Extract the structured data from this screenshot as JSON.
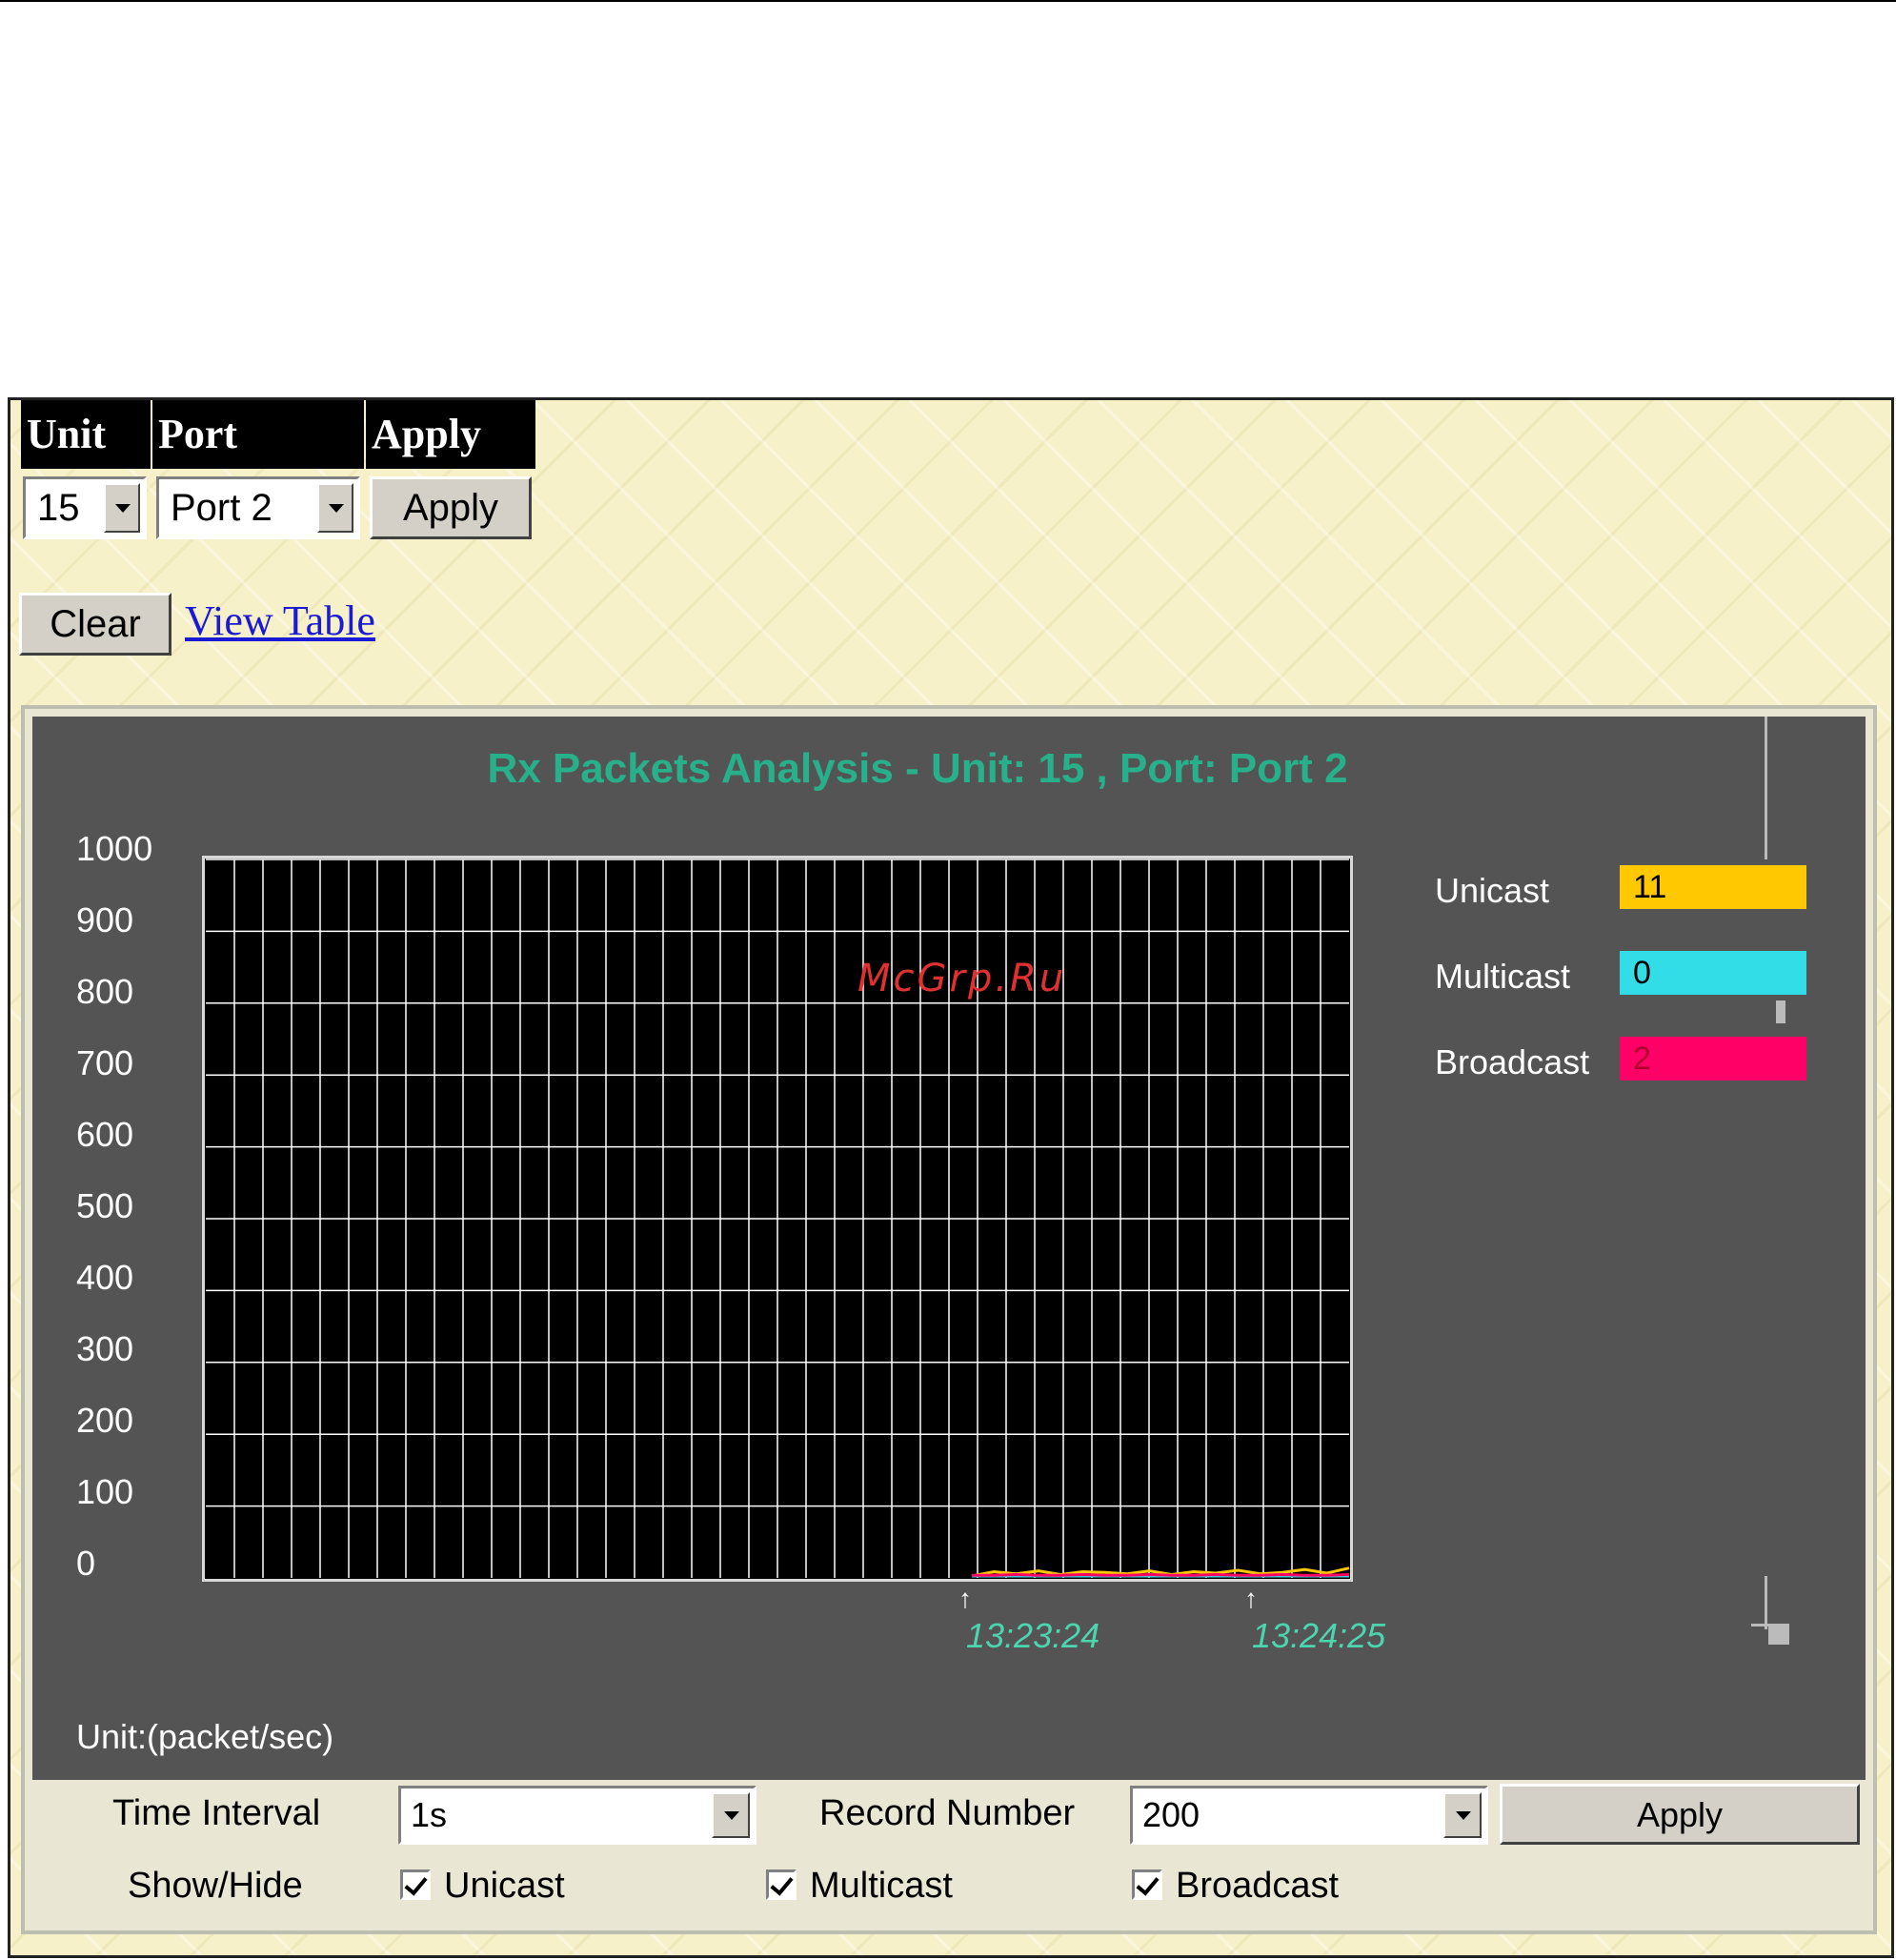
{
  "selector": {
    "unit_header": "Unit",
    "port_header": "Port",
    "apply_header": "Apply",
    "unit_value": "15",
    "port_value": "Port 2",
    "apply_label": "Apply"
  },
  "actions": {
    "clear_label": "Clear",
    "view_table_label": "View Table"
  },
  "watermark": "McGrp.Ru",
  "chart_data": {
    "type": "line",
    "title": "Rx Packets Analysis - Unit: 15 , Port: Port 2",
    "ylim": [
      0,
      1000
    ],
    "yticks": [
      "1000",
      "900",
      "800",
      "700",
      "600",
      "500",
      "400",
      "300",
      "200",
      "100",
      "0"
    ],
    "x_labels": [
      "13:23:24",
      "13:24:25"
    ],
    "unit_label": "Unit:(packet/sec)",
    "grid": true,
    "legend_position": "right",
    "series": [
      {
        "name": "Unicast",
        "current": "11",
        "color": "#ffc800",
        "values": [
          0,
          6,
          3,
          7,
          2,
          6,
          5,
          3,
          7,
          2,
          6,
          4,
          8,
          3,
          5,
          9,
          4,
          11
        ]
      },
      {
        "name": "Multicast",
        "current": "0",
        "color": "#33dde8",
        "values": [
          0,
          0,
          0,
          0,
          0,
          0,
          0,
          0,
          0,
          0,
          0,
          0,
          0,
          0,
          0,
          0,
          0,
          0
        ]
      },
      {
        "name": "Broadcast",
        "current": "2",
        "color": "#ff0066",
        "values": [
          1,
          1,
          2,
          1,
          1,
          2,
          1,
          1,
          2,
          1,
          1,
          2,
          1,
          1,
          2,
          1,
          1,
          2
        ]
      }
    ]
  },
  "controls": {
    "time_interval_label": "Time Interval",
    "time_interval_value": "1s",
    "record_number_label": "Record Number",
    "record_number_value": "200",
    "apply_label": "Apply",
    "show_hide_label": "Show/Hide",
    "unicast_label": "Unicast",
    "multicast_label": "Multicast",
    "broadcast_label": "Broadcast"
  }
}
